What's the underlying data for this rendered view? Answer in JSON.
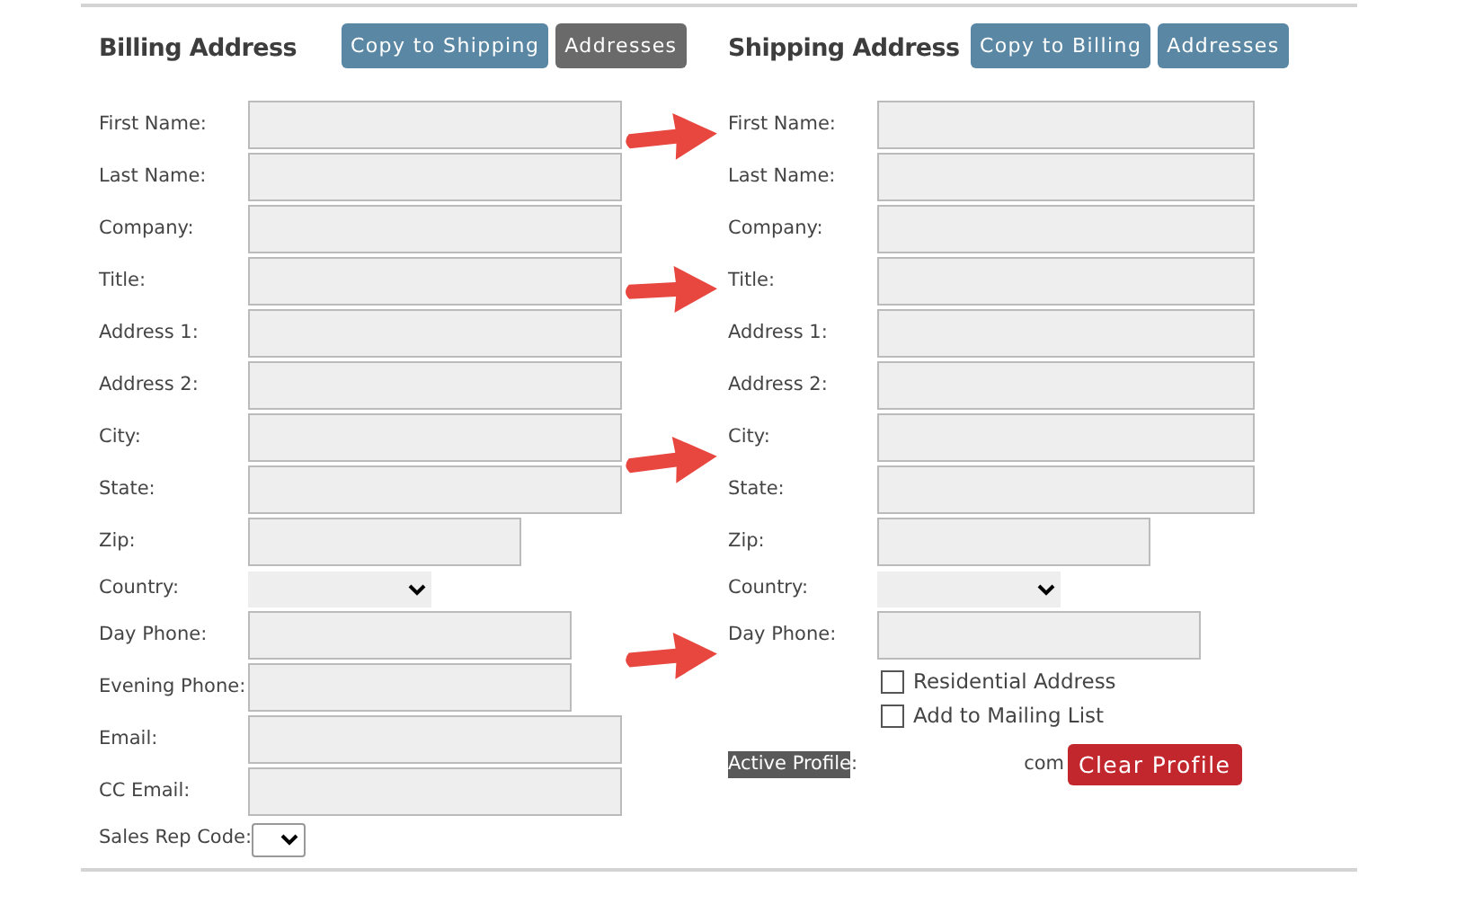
{
  "billing": {
    "title": "Billing Address",
    "buttons": [
      {
        "label": "Copy to Shipping",
        "kind": "primary"
      },
      {
        "label": "Addresses",
        "kind": "secondary"
      }
    ],
    "fields": [
      {
        "label": "First Name:",
        "kind": "text"
      },
      {
        "label": "Last Name:",
        "kind": "text"
      },
      {
        "label": "Company:",
        "kind": "text"
      },
      {
        "label": "Title:",
        "kind": "text"
      },
      {
        "label": "Address 1:",
        "kind": "text"
      },
      {
        "label": "Address 2:",
        "kind": "text"
      },
      {
        "label": "City:",
        "kind": "text"
      },
      {
        "label": "State:",
        "kind": "text"
      },
      {
        "label": "Zip:",
        "kind": "zip"
      },
      {
        "label": "Country:",
        "kind": "select"
      },
      {
        "label": "Day Phone:",
        "kind": "phone"
      },
      {
        "label": "Evening Phone:",
        "kind": "phone"
      },
      {
        "label": "Email:",
        "kind": "text"
      },
      {
        "label": "CC Email:",
        "kind": "text"
      },
      {
        "label": "Sales Rep Code:",
        "kind": "code-select"
      }
    ]
  },
  "shipping": {
    "title": "Shipping Address",
    "buttons": [
      {
        "label": "Copy to Billing",
        "kind": "primary"
      },
      {
        "label": "Addresses",
        "kind": "primary"
      }
    ],
    "fields": [
      {
        "label": "First Name:",
        "kind": "text"
      },
      {
        "label": "Last Name:",
        "kind": "text"
      },
      {
        "label": "Company:",
        "kind": "text"
      },
      {
        "label": "Title:",
        "kind": "text"
      },
      {
        "label": "Address 1:",
        "kind": "text"
      },
      {
        "label": "Address 2:",
        "kind": "text"
      },
      {
        "label": "City:",
        "kind": "text"
      },
      {
        "label": "State:",
        "kind": "text"
      },
      {
        "label": "Zip:",
        "kind": "zip"
      },
      {
        "label": "Country:",
        "kind": "select"
      },
      {
        "label": "Day Phone:",
        "kind": "phone-wide"
      }
    ],
    "checkboxes": [
      {
        "label": "Residential Address",
        "checked": false
      },
      {
        "label": "Add to Mailing List",
        "checked": false
      }
    ],
    "active_profile": {
      "label": "Active Profile",
      "label_suffix": ":",
      "value": "com",
      "button": "Clear Profile"
    }
  },
  "annotations": [
    {
      "kind": "arrow"
    },
    {
      "kind": "arrow"
    },
    {
      "kind": "arrow"
    },
    {
      "kind": "arrow"
    }
  ]
}
